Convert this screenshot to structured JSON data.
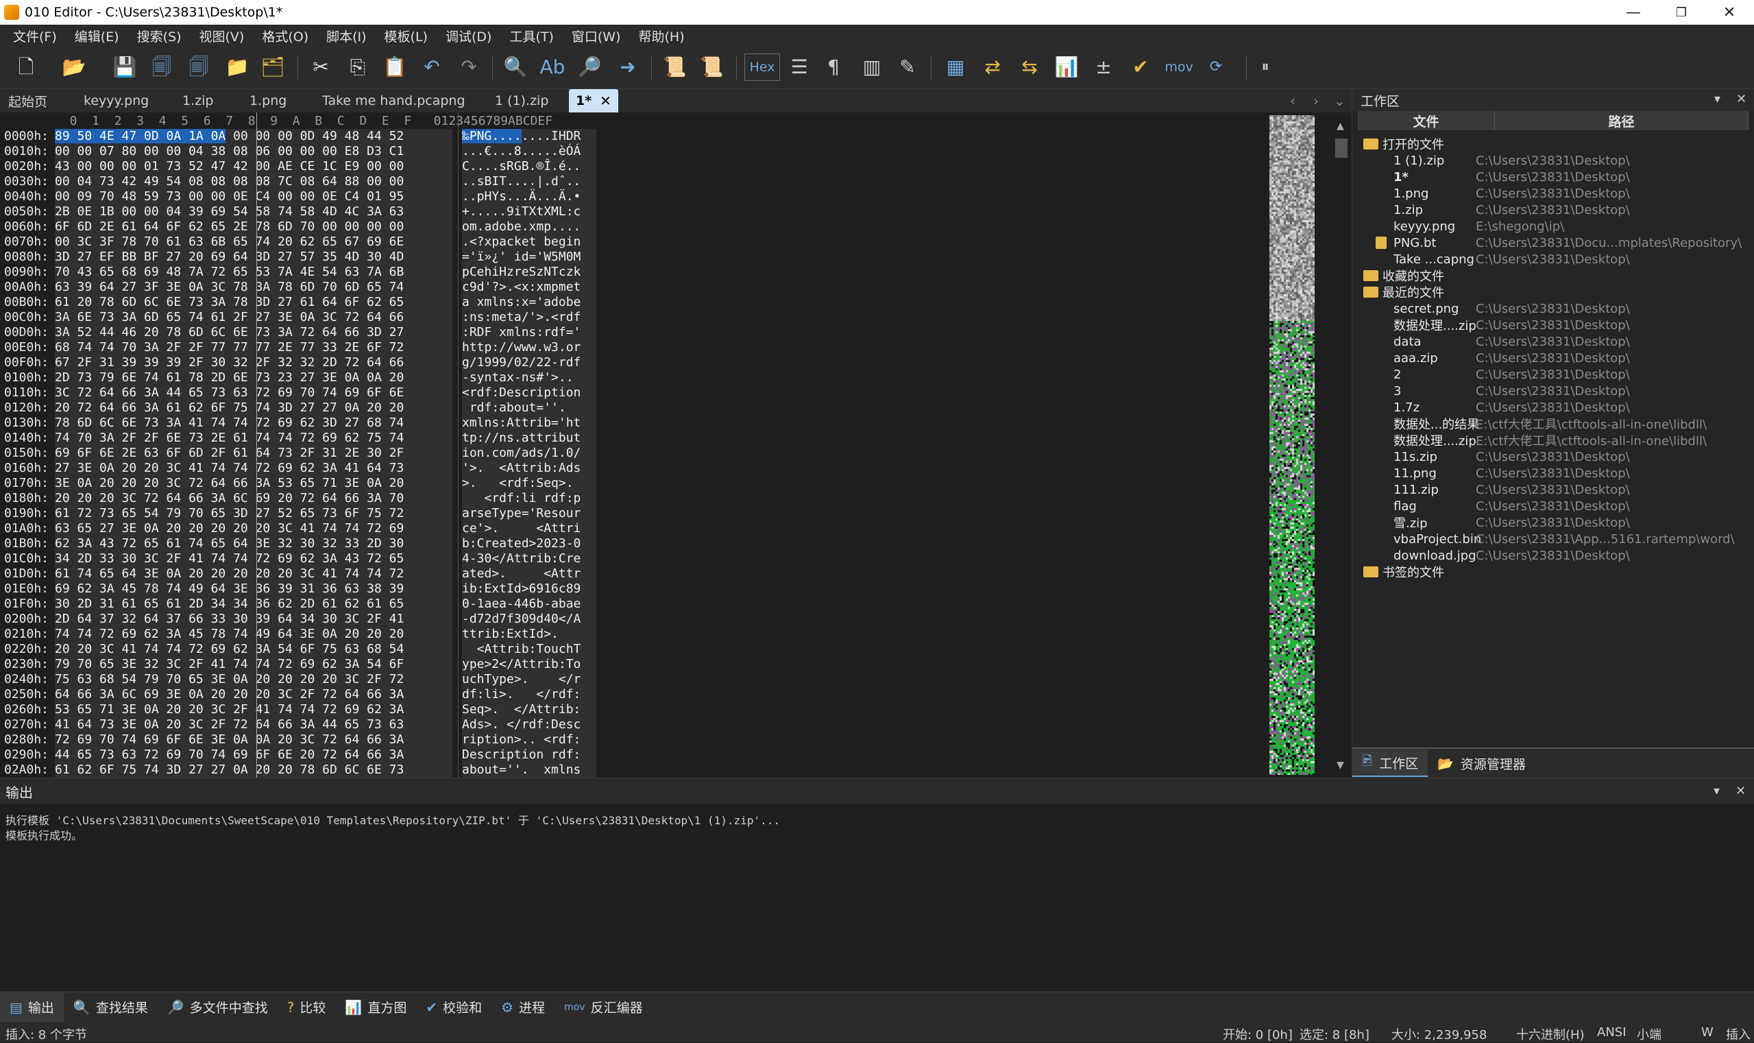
{
  "window": {
    "title": "010 Editor - C:\\Users\\23831\\Desktop\\1*",
    "minimize": "—",
    "maximize": "❐",
    "close": "✕"
  },
  "menu": [
    "文件(F)",
    "编辑(E)",
    "搜索(S)",
    "视图(V)",
    "格式(O)",
    "脚本(I)",
    "模板(L)",
    "调试(D)",
    "工具(T)",
    "窗口(W)",
    "帮助(H)"
  ],
  "toolbar": {
    "hex_label": "Hex",
    "mov_label": "mov"
  },
  "tabs": [
    "起始页",
    "keyyy.png",
    "1.zip",
    "1.png",
    "Take me hand.pcapng",
    "1 (1).zip",
    "1*"
  ],
  "hex": {
    "column_header": "  0  1  2  3  4  5  6  7  8  9  A  B  C  D  E  F   0123456789ABCDEF",
    "rows": [
      {
        "o": "0000h:",
        "h": "89 50 4E 47 0D 0A 1A 0A 00 00 00 0D 49 48 44 52",
        "a": "‰PNG........IHDR"
      },
      {
        "o": "0010h:",
        "h": "00 00 07 80 00 00 04 38 08 06 00 00 00 E8 D3 C1",
        "a": "...€...8.....èÓÁ"
      },
      {
        "o": "0020h:",
        "h": "43 00 00 00 01 73 52 47 42 00 AE CE 1C E9 00 00",
        "a": "C....sRGB.®Î.é.."
      },
      {
        "o": "0030h:",
        "h": "00 04 73 42 49 54 08 08 08 08 7C 08 64 88 00 00",
        "a": "..sBIT....|.dˆ.."
      },
      {
        "o": "0040h:",
        "h": "00 09 70 48 59 73 00 00 0E C4 00 00 0E C4 01 95",
        "a": "..pHYs...Ä...Ä.•"
      },
      {
        "o": "0050h:",
        "h": "2B 0E 1B 00 00 04 39 69 54 58 74 58 4D 4C 3A 63",
        "a": "+.....9iTXtXML:c"
      },
      {
        "o": "0060h:",
        "h": "6F 6D 2E 61 64 6F 62 65 2E 78 6D 70 00 00 00 00",
        "a": "om.adobe.xmp...."
      },
      {
        "o": "0070h:",
        "h": "00 3C 3F 78 70 61 63 6B 65 74 20 62 65 67 69 6E",
        "a": ".<?xpacket begin"
      },
      {
        "o": "0080h:",
        "h": "3D 27 EF BB BF 27 20 69 64 3D 27 57 35 4D 30 4D",
        "a": "='ï»¿' id='W5M0M"
      },
      {
        "o": "0090h:",
        "h": "70 43 65 68 69 48 7A 72 65 53 7A 4E 54 63 7A 6B",
        "a": "pCehiHzreSzNTczk"
      },
      {
        "o": "00A0h:",
        "h": "63 39 64 27 3F 3E 0A 3C 78 3A 78 6D 70 6D 65 74",
        "a": "c9d'?>.<x:xmpmet"
      },
      {
        "o": "00B0h:",
        "h": "61 20 78 6D 6C 6E 73 3A 78 3D 27 61 64 6F 62 65",
        "a": "a xmlns:x='adobe"
      },
      {
        "o": "00C0h:",
        "h": "3A 6E 73 3A 6D 65 74 61 2F 27 3E 0A 3C 72 64 66",
        "a": ":ns:meta/'>.<rdf"
      },
      {
        "o": "00D0h:",
        "h": "3A 52 44 46 20 78 6D 6C 6E 73 3A 72 64 66 3D 27",
        "a": ":RDF xmlns:rdf='"
      },
      {
        "o": "00E0h:",
        "h": "68 74 74 70 3A 2F 2F 77 77 77 2E 77 33 2E 6F 72",
        "a": "http://www.w3.or"
      },
      {
        "o": "00F0h:",
        "h": "67 2F 31 39 39 39 2F 30 32 2F 32 32 2D 72 64 66",
        "a": "g/1999/02/22-rdf"
      },
      {
        "o": "0100h:",
        "h": "2D 73 79 6E 74 61 78 2D 6E 73 23 27 3E 0A 0A 20",
        "a": "-syntax-ns#'>.. "
      },
      {
        "o": "0110h:",
        "h": "3C 72 64 66 3A 44 65 73 63 72 69 70 74 69 6F 6E",
        "a": "<rdf:Description"
      },
      {
        "o": "0120h:",
        "h": "20 72 64 66 3A 61 62 6F 75 74 3D 27 27 0A 20 20",
        "a": " rdf:about=''.  "
      },
      {
        "o": "0130h:",
        "h": "78 6D 6C 6E 73 3A 41 74 74 72 69 62 3D 27 68 74",
        "a": "xmlns:Attrib='ht"
      },
      {
        "o": "0140h:",
        "h": "74 70 3A 2F 2F 6E 73 2E 61 74 74 72 69 62 75 74",
        "a": "tp://ns.attribut"
      },
      {
        "o": "0150h:",
        "h": "69 6F 6E 2E 63 6F 6D 2F 61 64 73 2F 31 2E 30 2F",
        "a": "ion.com/ads/1.0/"
      },
      {
        "o": "0160h:",
        "h": "27 3E 0A 20 20 3C 41 74 74 72 69 62 3A 41 64 73",
        "a": "'>.  <Attrib:Ads"
      },
      {
        "o": "0170h:",
        "h": "3E 0A 20 20 20 3C 72 64 66 3A 53 65 71 3E 0A 20",
        "a": ">.   <rdf:Seq>. "
      },
      {
        "o": "0180h:",
        "h": "20 20 20 3C 72 64 66 3A 6C 69 20 72 64 66 3A 70",
        "a": "   <rdf:li rdf:p"
      },
      {
        "o": "0190h:",
        "h": "61 72 73 65 54 79 70 65 3D 27 52 65 73 6F 75 72",
        "a": "arseType='Resour"
      },
      {
        "o": "01A0h:",
        "h": "63 65 27 3E 0A 20 20 20 20 20 3C 41 74 74 72 69",
        "a": "ce'>.     <Attri"
      },
      {
        "o": "01B0h:",
        "h": "62 3A 43 72 65 61 74 65 64 3E 32 30 32 33 2D 30",
        "a": "b:Created>2023-0"
      },
      {
        "o": "01C0h:",
        "h": "34 2D 33 30 3C 2F 41 74 74 72 69 62 3A 43 72 65",
        "a": "4-30</Attrib:Cre"
      },
      {
        "o": "01D0h:",
        "h": "61 74 65 64 3E 0A 20 20 20 20 20 3C 41 74 74 72",
        "a": "ated>.     <Attr"
      },
      {
        "o": "01E0h:",
        "h": "69 62 3A 45 78 74 49 64 3E 36 39 31 36 63 38 39",
        "a": "ib:ExtId>6916c89"
      },
      {
        "o": "01F0h:",
        "h": "30 2D 31 61 65 61 2D 34 34 36 62 2D 61 62 61 65",
        "a": "0-1aea-446b-abae"
      },
      {
        "o": "0200h:",
        "h": "2D 64 37 32 64 37 66 33 30 39 64 34 30 3C 2F 41",
        "a": "-d72d7f309d40</A"
      },
      {
        "o": "0210h:",
        "h": "74 74 72 69 62 3A 45 78 74 49 64 3E 0A 20 20 20",
        "a": "ttrib:ExtId>.   "
      },
      {
        "o": "0220h:",
        "h": "20 20 3C 41 74 74 72 69 62 3A 54 6F 75 63 68 54",
        "a": "  <Attrib:TouchT"
      },
      {
        "o": "0230h:",
        "h": "79 70 65 3E 32 3C 2F 41 74 74 72 69 62 3A 54 6F",
        "a": "ype>2</Attrib:To"
      },
      {
        "o": "0240h:",
        "h": "75 63 68 54 79 70 65 3E 0A 20 20 20 20 3C 2F 72",
        "a": "uchType>.    </r"
      },
      {
        "o": "0250h:",
        "h": "64 66 3A 6C 69 3E 0A 20 20 20 3C 2F 72 64 66 3A",
        "a": "df:li>.   </rdf:"
      },
      {
        "o": "0260h:",
        "h": "53 65 71 3E 0A 20 20 3C 2F 41 74 74 72 69 62 3A",
        "a": "Seq>.  </Attrib:"
      },
      {
        "o": "0270h:",
        "h": "41 64 73 3E 0A 20 3C 2F 72 64 66 3A 44 65 73 63",
        "a": "Ads>. </rdf:Desc"
      },
      {
        "o": "0280h:",
        "h": "72 69 70 74 69 6F 6E 3E 0A 0A 20 3C 72 64 66 3A",
        "a": "ription>.. <rdf:"
      },
      {
        "o": "0290h:",
        "h": "44 65 73 63 72 69 70 74 69 6F 6E 20 72 64 66 3A",
        "a": "Description rdf:"
      },
      {
        "o": "02A0h:",
        "h": "61 62 6F 75 74 3D 27 27 0A 20 20 78 6D 6C 6E 73",
        "a": "about=''.  xmlns"
      }
    ]
  },
  "workspace": {
    "title": "工作区",
    "col_file": "文件",
    "col_path": "路径",
    "tree": [
      {
        "name": "打开的文件",
        "path": "",
        "folder": true,
        "indent": 0
      },
      {
        "name": "1 (1).zip",
        "path": "C:\\Users\\23831\\Desktop\\",
        "indent": 1
      },
      {
        "name": "1*",
        "path": "C:\\Users\\23831\\Desktop\\",
        "indent": 1,
        "bold": true
      },
      {
        "name": "1.png",
        "path": "C:\\Users\\23831\\Desktop\\",
        "indent": 1
      },
      {
        "name": "1.zip",
        "path": "C:\\Users\\23831\\Desktop\\",
        "indent": 1
      },
      {
        "name": "keyyy.png",
        "path": "E:\\shegong\\ip\\",
        "indent": 1
      },
      {
        "name": "PNG.bt",
        "path": "C:\\Users\\23831\\Docu...mplates\\Repository\\",
        "indent": 1,
        "doc": true
      },
      {
        "name": "Take ...capng",
        "path": "C:\\Users\\23831\\Desktop\\",
        "indent": 1
      },
      {
        "name": "收藏的文件",
        "path": "",
        "folder": true,
        "indent": 0
      },
      {
        "name": "最近的文件",
        "path": "",
        "folder": true,
        "indent": 0
      },
      {
        "name": "secret.png",
        "path": "C:\\Users\\23831\\Desktop\\",
        "indent": 1
      },
      {
        "name": "数据处理....zip",
        "path": "C:\\Users\\23831\\Desktop\\",
        "indent": 1
      },
      {
        "name": "data",
        "path": "C:\\Users\\23831\\Desktop\\",
        "indent": 1
      },
      {
        "name": "aaa.zip",
        "path": "C:\\Users\\23831\\Desktop\\",
        "indent": 1
      },
      {
        "name": "2",
        "path": "C:\\Users\\23831\\Desktop\\",
        "indent": 1
      },
      {
        "name": "3",
        "path": "C:\\Users\\23831\\Desktop\\",
        "indent": 1
      },
      {
        "name": "1.7z",
        "path": "C:\\Users\\23831\\Desktop\\",
        "indent": 1
      },
      {
        "name": "数据处...的结果",
        "path": "E:\\ctf大佬工具\\ctftools-all-in-one\\libdll\\",
        "indent": 1
      },
      {
        "name": "数据处理....zip",
        "path": "E:\\ctf大佬工具\\ctftools-all-in-one\\libdll\\",
        "indent": 1
      },
      {
        "name": "11s.zip",
        "path": "C:\\Users\\23831\\Desktop\\",
        "indent": 1
      },
      {
        "name": "11.png",
        "path": "C:\\Users\\23831\\Desktop\\",
        "indent": 1
      },
      {
        "name": "111.zip",
        "path": "C:\\Users\\23831\\Desktop\\",
        "indent": 1
      },
      {
        "name": "flag",
        "path": "C:\\Users\\23831\\Desktop\\",
        "indent": 1
      },
      {
        "name": "雪.zip",
        "path": "C:\\Users\\23831\\Desktop\\",
        "indent": 1
      },
      {
        "name": "vbaProject.bin",
        "path": "C:\\Users\\23831\\App...5161.rartemp\\word\\",
        "indent": 1
      },
      {
        "name": "download.jpg",
        "path": "C:\\Users\\23831\\Desktop\\",
        "indent": 1
      },
      {
        "name": "书签的文件",
        "path": "",
        "folder": true,
        "indent": 0
      }
    ],
    "tab_workspace": "工作区",
    "tab_explorer": "资源管理器"
  },
  "output": {
    "title": "输出",
    "lines": [
      "执行模板 'C:\\Users\\23831\\Documents\\SweetScape\\010 Templates\\Repository\\ZIP.bt' 于 'C:\\Users\\23831\\Desktop\\1 (1).zip'...",
      "模板执行成功。"
    ]
  },
  "bottom_tabs": [
    "输出",
    "查找结果",
    "多文件中查找",
    "比较",
    "直方图",
    "校验和",
    "进程",
    "反汇编器"
  ],
  "status": {
    "left": "插入: 8 个字节",
    "start": "开始: 0 [0h]",
    "selected": "选定: 8 [8h]",
    "size": "大小: 2,239,958",
    "mode": "十六进制(H)",
    "encoding": "ANSI",
    "endian": "小端",
    "w": "W",
    "ins": "插入"
  }
}
